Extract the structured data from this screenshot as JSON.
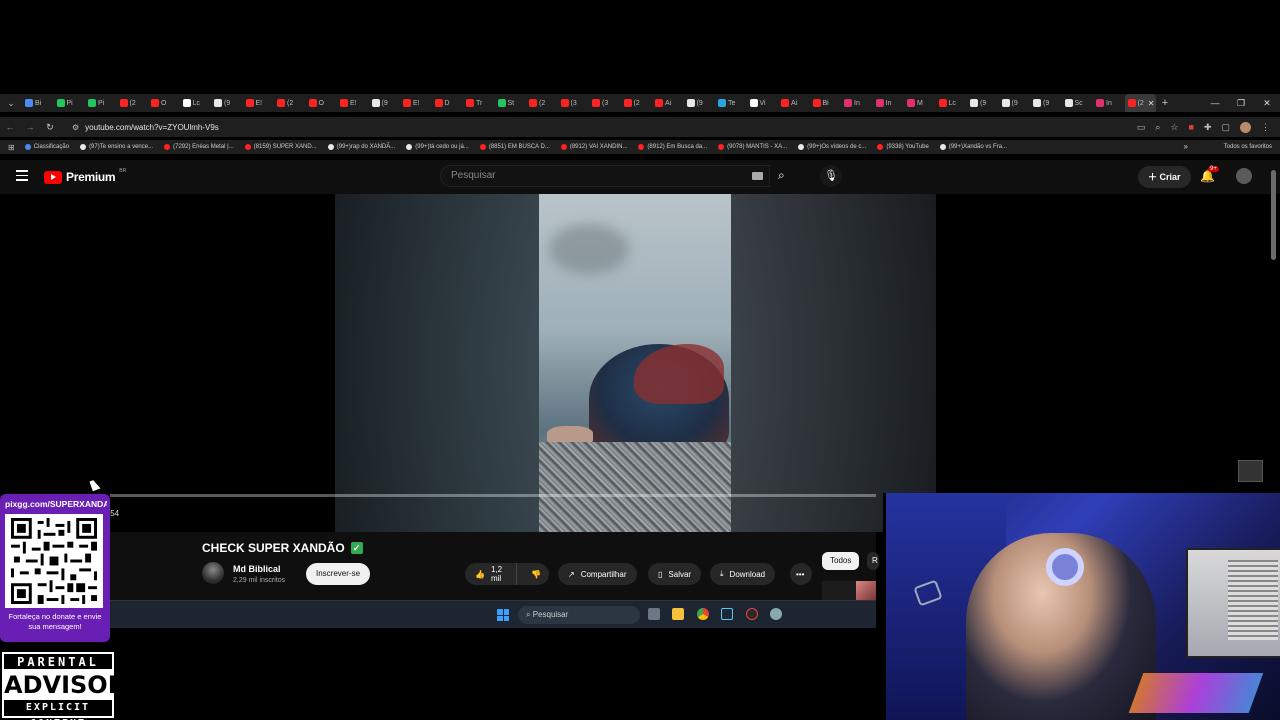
{
  "browser": {
    "tabs": [
      {
        "label": "Bi",
        "color": "#4c8bf5"
      },
      {
        "label": "Pi",
        "color": "#22c55e"
      },
      {
        "label": "Pi",
        "color": "#22c55e"
      },
      {
        "label": "(2",
        "color": "#ff2222"
      },
      {
        "label": "O",
        "color": "#ff2222"
      },
      {
        "label": "Lc",
        "color": "#ffffff"
      },
      {
        "label": "(9",
        "color": "#e8e8e8"
      },
      {
        "label": "E!",
        "color": "#ff2222"
      },
      {
        "label": "(2",
        "color": "#ff2222"
      },
      {
        "label": "O",
        "color": "#ff2222"
      },
      {
        "label": "E!",
        "color": "#ff2222"
      },
      {
        "label": "(9",
        "color": "#e8e8e8"
      },
      {
        "label": "E!",
        "color": "#ff2222"
      },
      {
        "label": "D",
        "color": "#ff2222"
      },
      {
        "label": "Tr",
        "color": "#ff2222"
      },
      {
        "label": "St",
        "color": "#22c55e"
      },
      {
        "label": "(2",
        "color": "#ff2222"
      },
      {
        "label": "(3",
        "color": "#ff2222"
      },
      {
        "label": "(3",
        "color": "#ff2222"
      },
      {
        "label": "(2",
        "color": "#ff2222"
      },
      {
        "label": "Ai",
        "color": "#ff2222"
      },
      {
        "label": "(9",
        "color": "#e8e8e8"
      },
      {
        "label": "Te",
        "color": "#2aa3e0"
      },
      {
        "label": "Vi",
        "color": "#ffffff"
      },
      {
        "label": "Ai",
        "color": "#ff2222"
      },
      {
        "label": "Bi",
        "color": "#ff2222"
      },
      {
        "label": "In",
        "color": "#e1306c"
      },
      {
        "label": "In",
        "color": "#e1306c"
      },
      {
        "label": "M",
        "color": "#e1306c"
      },
      {
        "label": "Lc",
        "color": "#ff2222"
      },
      {
        "label": "(9",
        "color": "#e8e8e8"
      },
      {
        "label": "(9",
        "color": "#e8e8e8"
      },
      {
        "label": "(9",
        "color": "#e8e8e8"
      },
      {
        "label": "Sc",
        "color": "#e8e8e8"
      },
      {
        "label": "In",
        "color": "#e1306c"
      }
    ],
    "active_tab": {
      "label": "(2"
    },
    "url": "youtube.com/watch?v=ZYOUlmh-V9s",
    "bookmarks": [
      {
        "label": "Classificação",
        "color": "#4c8bf5"
      },
      {
        "label": "(97)Te ensino a vence...",
        "color": "#e8e8e8"
      },
      {
        "label": "(7292) Enéas Metal |...",
        "color": "#ff2222"
      },
      {
        "label": "(8159) SUPER XAND...",
        "color": "#ff2222"
      },
      {
        "label": "(99+)rap do XANDÃ...",
        "color": "#e8e8e8"
      },
      {
        "label": "(99+)tá cedo ou já...",
        "color": "#e8e8e8"
      },
      {
        "label": "(8851) EM BUSCA D...",
        "color": "#ff2222"
      },
      {
        "label": "(8912) VAI XANDIN...",
        "color": "#ff2222"
      },
      {
        "label": "(8912) Em Busca da...",
        "color": "#ff2222"
      },
      {
        "label": "(9078) MANTIS - XA...",
        "color": "#ff2222"
      },
      {
        "label": "(99+)Os vídeos de c...",
        "color": "#e8e8e8"
      },
      {
        "label": "(9338) YouTube",
        "color": "#ff2222"
      },
      {
        "label": "(99+)Xandão vs Fra...",
        "color": "#e8e8e8"
      }
    ],
    "all_bookmarks": "Todos os favoritos"
  },
  "youtube": {
    "logo_text": "Premium",
    "logo_country": "BR",
    "search_placeholder": "Pesquisar",
    "create_label": "Criar",
    "notif_badge": "9+"
  },
  "video": {
    "time_fragment": ":54",
    "title": "CHECK SUPER XANDÃO",
    "channel": "Md Biblical",
    "subscribers": "2,29 mil inscritos",
    "subscribe_label": "Inscrever-se",
    "likes": "1,2 mil",
    "share_label": "Compartilhar",
    "save_label": "Salvar",
    "download_label": "Download",
    "filter_all": "Todos",
    "filter_next": "R"
  },
  "taskbar": {
    "search_placeholder": "Pesquisar"
  },
  "overlay": {
    "qr_url": "pixgg.com/SUPERXANDAO",
    "qr_message": "Fortaleça no donate e envie sua mensagem!",
    "advisory_line1": "PARENTAL",
    "advisory_line2": "ADVISORY",
    "advisory_line3": "EXPLICIT CONTENT"
  }
}
